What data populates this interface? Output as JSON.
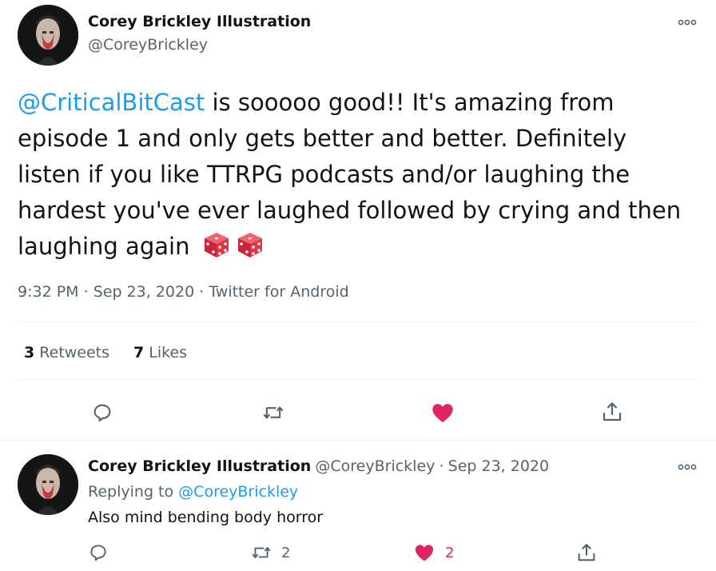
{
  "main_tweet": {
    "author_name": "Corey Brickley Illustration",
    "author_handle": "@CoreyBrickley",
    "mention": "@CriticalBitCast",
    "text": " is sooooo good!! It's amazing from episode 1 and only gets better and better. Definitely listen if you like TTRPG podcasts and/or laughing the hardest you've ever laughed followed by crying and then laughing again ",
    "emoji": [
      "game-die",
      "game-die"
    ],
    "time": "9:32 PM",
    "date": "Sep 23, 2020",
    "source": "Twitter for Android",
    "separator": "·",
    "retweets_count": "3",
    "retweets_label": "Retweets",
    "likes_count": "7",
    "likes_label": "Likes",
    "liked": true
  },
  "reply_tweet": {
    "author_name": "Corey Brickley Illustration",
    "author_handle": "@CoreyBrickley",
    "separator": "·",
    "date": "Sep 23, 2020",
    "replying_to_label": "Replying to",
    "replying_to_handle": "@CoreyBrickley",
    "text": "Also mind bending body horror",
    "retweet_count": "2",
    "like_count": "2",
    "liked": true
  },
  "colors": {
    "accent": "#1d9bf0",
    "like": "#e0245e",
    "secondary_text": "#536471",
    "divider": "#eff3f4"
  },
  "icons": {
    "reply": "speech-bubble-icon",
    "retweet": "retweet-arrows-icon",
    "like": "heart-icon",
    "share": "share-upload-icon",
    "more": "three-dots-icon"
  }
}
